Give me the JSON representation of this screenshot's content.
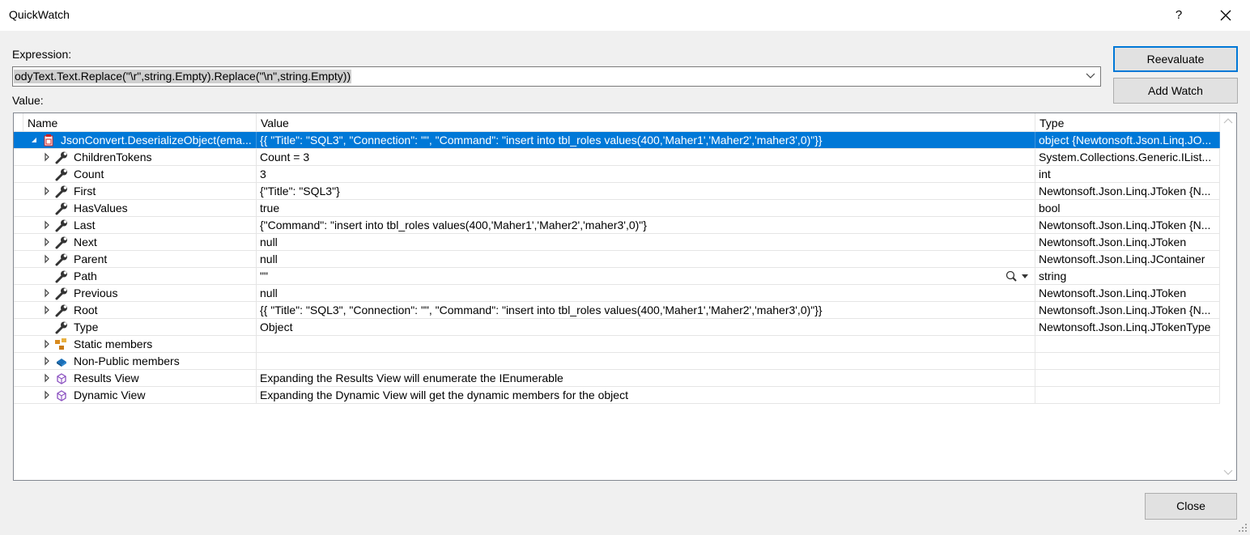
{
  "window": {
    "title": "QuickWatch",
    "help": "?"
  },
  "expression": {
    "label": "Expression:",
    "value": "odyText.Text.Replace(\"\\r\",string.Empty).Replace(\"\\n\",string.Empty))"
  },
  "buttons": {
    "reevaluate": "Reevaluate",
    "add_watch": "Add Watch",
    "close": "Close"
  },
  "value_label": "Value:",
  "columns": {
    "name": "Name",
    "value": "Value",
    "type": "Type"
  },
  "rows": [
    {
      "name": "JsonConvert.DeserializeObject(ema...",
      "value": "{{  \"Title\": \"SQL3\",  \"Connection\": \"\",  \"Command\": \"insert into tbl_roles values(400,'Maher1','Maher2','maher3',0)\"}}",
      "type": "object {Newtonsoft.Json.Linq.JO...",
      "icon": "object-icon",
      "expander": "expanded",
      "level": 0
    },
    {
      "name": "ChildrenTokens",
      "value": "Count = 3",
      "type": "System.Collections.Generic.IList...",
      "icon": "property-icon",
      "expander": "collapsed",
      "level": 1
    },
    {
      "name": "Count",
      "value": "3",
      "type": "int",
      "icon": "property-icon",
      "expander": "none",
      "level": 1
    },
    {
      "name": "First",
      "value": "{\"Title\": \"SQL3\"}",
      "type": "Newtonsoft.Json.Linq.JToken {N...",
      "icon": "property-icon",
      "expander": "collapsed",
      "level": 1
    },
    {
      "name": "HasValues",
      "value": "true",
      "type": "bool",
      "icon": "property-icon",
      "expander": "none",
      "level": 1
    },
    {
      "name": "Last",
      "value": "{\"Command\": \"insert into tbl_roles values(400,'Maher1','Maher2','maher3',0)\"}",
      "type": "Newtonsoft.Json.Linq.JToken {N...",
      "icon": "property-icon",
      "expander": "collapsed",
      "level": 1
    },
    {
      "name": "Next",
      "value": "null",
      "type": "Newtonsoft.Json.Linq.JToken",
      "icon": "property-icon",
      "expander": "collapsed",
      "level": 1
    },
    {
      "name": "Parent",
      "value": "null",
      "type": "Newtonsoft.Json.Linq.JContainer",
      "icon": "property-icon",
      "expander": "collapsed",
      "level": 1
    },
    {
      "name": "Path",
      "value": "\"\"",
      "type": "string",
      "icon": "property-icon",
      "expander": "none",
      "level": 1,
      "inspect": true
    },
    {
      "name": "Previous",
      "value": "null",
      "type": "Newtonsoft.Json.Linq.JToken",
      "icon": "property-icon",
      "expander": "collapsed",
      "level": 1
    },
    {
      "name": "Root",
      "value": "{{  \"Title\": \"SQL3\",  \"Connection\": \"\",  \"Command\": \"insert into tbl_roles values(400,'Maher1','Maher2','maher3',0)\"}}",
      "type": "Newtonsoft.Json.Linq.JToken {N...",
      "icon": "property-icon",
      "expander": "collapsed",
      "level": 1
    },
    {
      "name": "Type",
      "value": "Object",
      "type": "Newtonsoft.Json.Linq.JTokenType",
      "icon": "property-icon",
      "expander": "none",
      "level": 1
    },
    {
      "name": "Static members",
      "value": "",
      "type": "",
      "icon": "static-members-icon",
      "expander": "collapsed",
      "level": 1
    },
    {
      "name": "Non-Public members",
      "value": "",
      "type": "",
      "icon": "non-public-members-icon",
      "expander": "collapsed",
      "level": 1
    },
    {
      "name": "Results View",
      "value": "Expanding the Results View will enumerate the IEnumerable",
      "type": "",
      "icon": "results-view-icon",
      "expander": "collapsed",
      "level": 1
    },
    {
      "name": "Dynamic View",
      "value": "Expanding the Dynamic View will get the dynamic members for the object",
      "type": "",
      "icon": "dynamic-view-icon",
      "expander": "collapsed",
      "level": 1
    }
  ],
  "colors": {
    "selection": "#0078d7",
    "grid_line": "#e5e5e5",
    "button_face": "#e1e1e1"
  }
}
